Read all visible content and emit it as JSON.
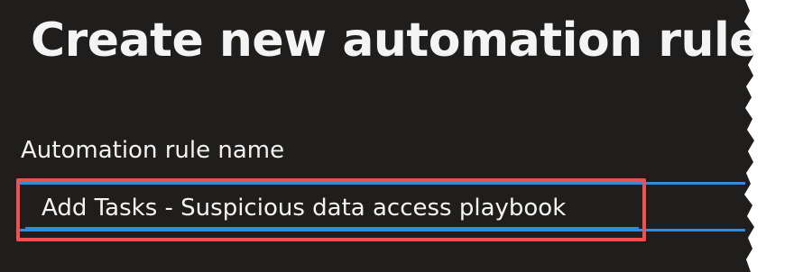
{
  "page": {
    "title": "Create new automation rule"
  },
  "form": {
    "rule_name_label": "Automation rule name",
    "rule_name_value": "Add Tasks - Suspicious data access playbook"
  },
  "colors": {
    "panel_background": "#1f1e1c",
    "text": "#f4f4f4",
    "accent_underline": "#2f8bdb",
    "highlight_border": "#f0504e"
  }
}
